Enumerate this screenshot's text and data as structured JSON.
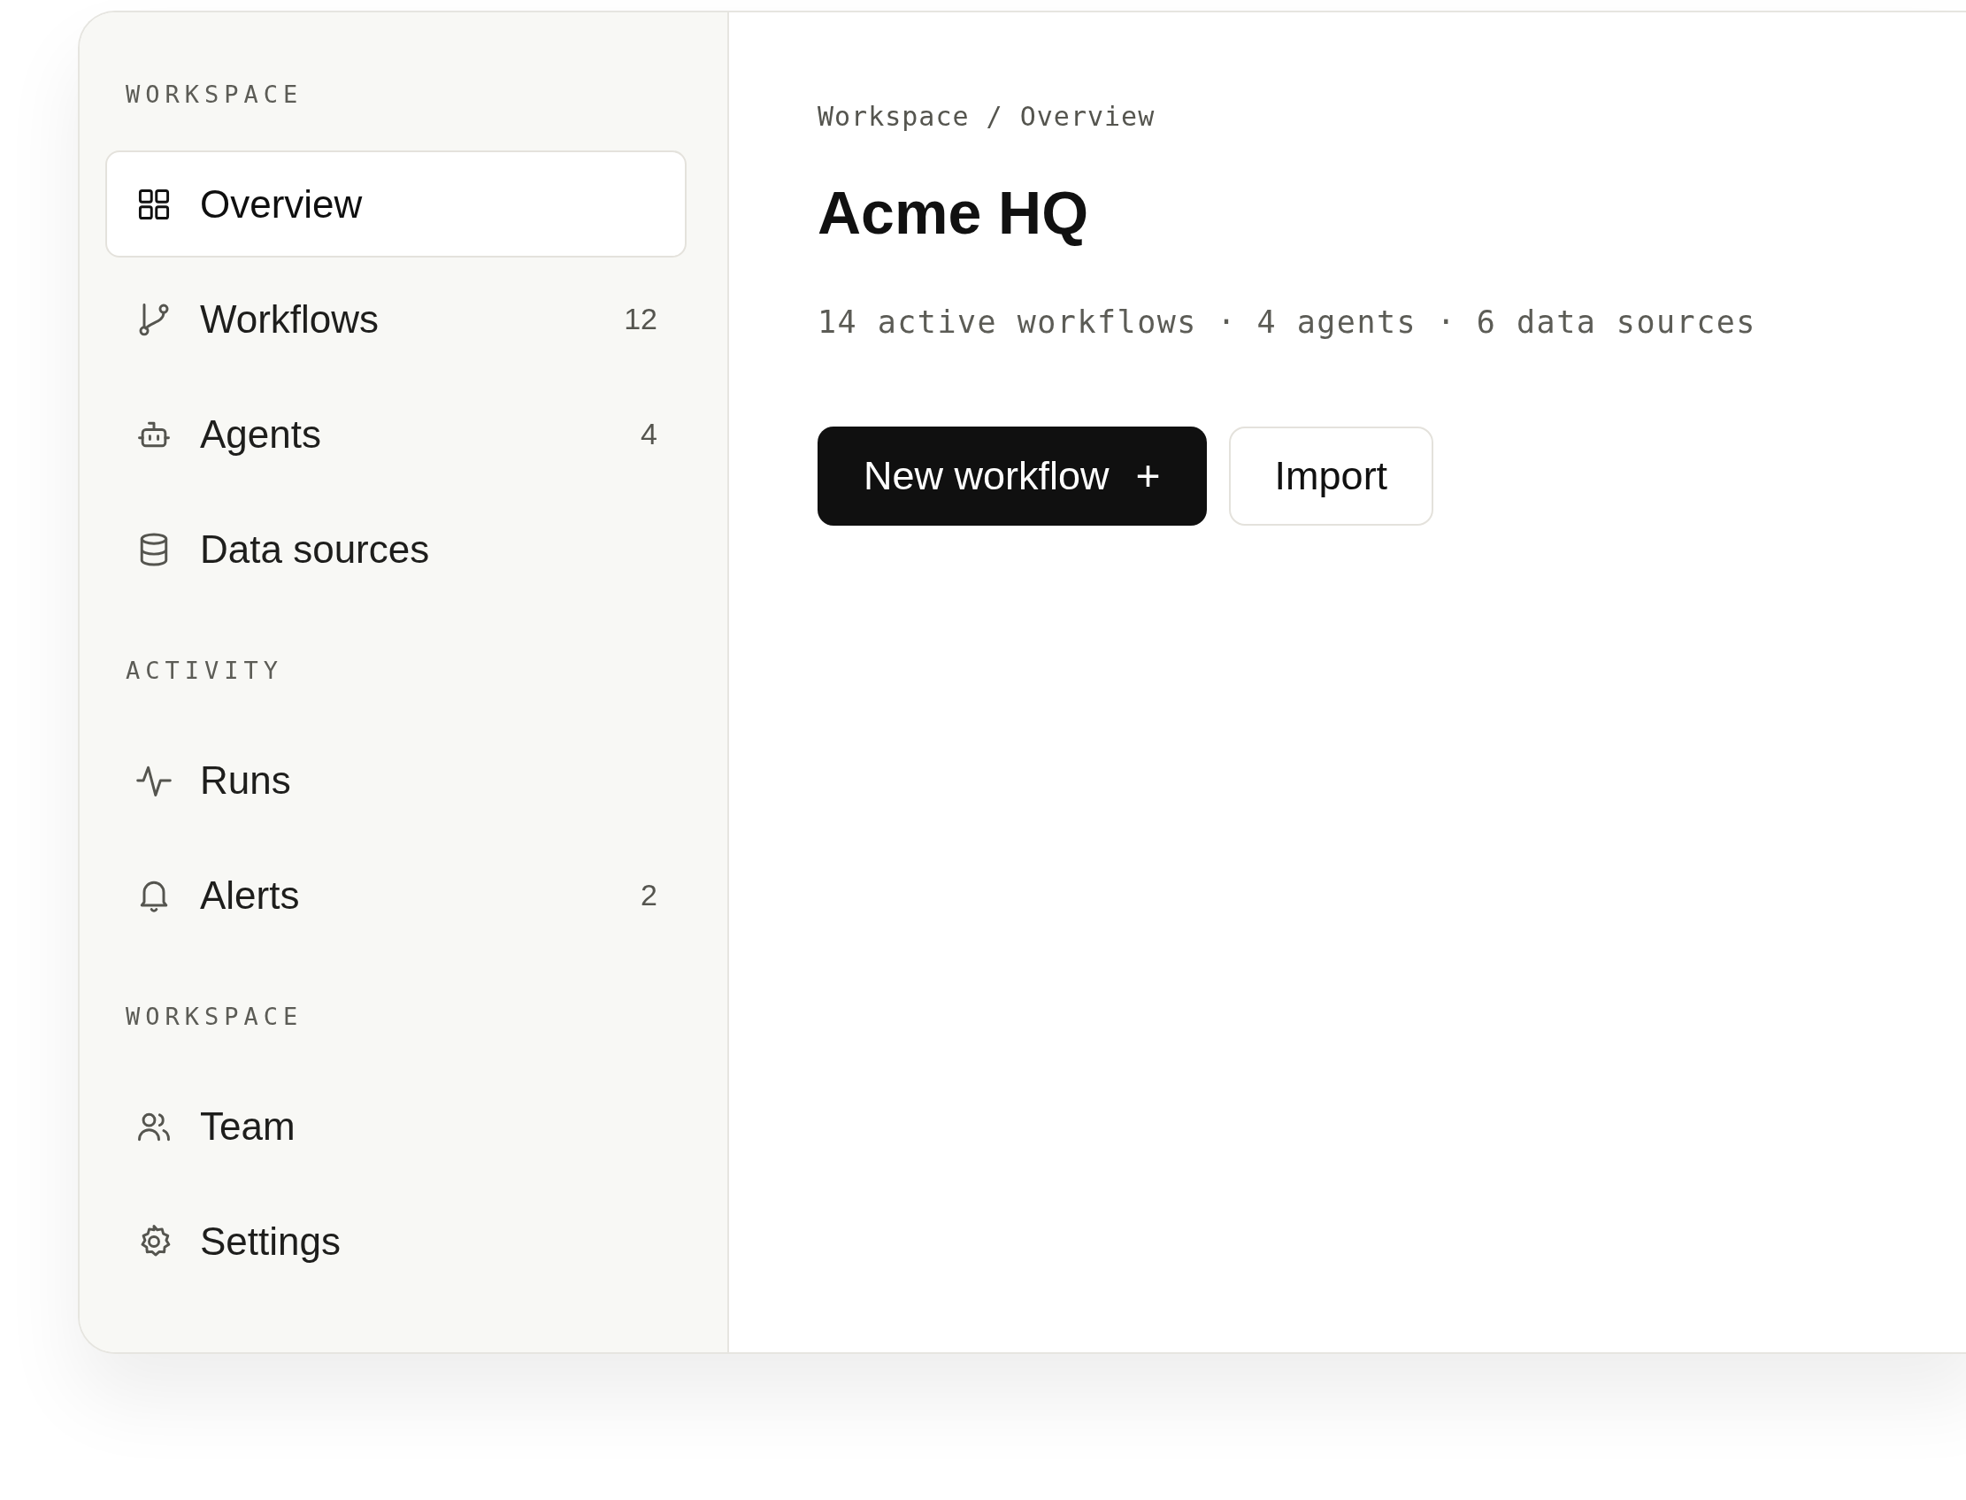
{
  "sidebar": {
    "sections": [
      {
        "label": "WORKSPACE",
        "items": [
          {
            "label": "Overview",
            "selected": true
          },
          {
            "label": "Workflows",
            "count": "12",
            "selected": false
          },
          {
            "label": "Agents",
            "count": "4",
            "selected": false
          },
          {
            "label": "Data sources",
            "selected": false
          }
        ]
      },
      {
        "label": "ACTIVITY",
        "items": [
          {
            "label": "Runs",
            "selected": false
          },
          {
            "label": "Alerts",
            "count": "2",
            "selected": false
          }
        ]
      },
      {
        "label": "WORKSPACE",
        "items": [
          {
            "label": "Team",
            "selected": false
          },
          {
            "label": "Settings",
            "selected": false
          }
        ]
      }
    ]
  },
  "main": {
    "breadcrumb": "Workspace / Overview",
    "title": "Acme HQ",
    "stats": "14 active workflows · 4 agents · 6 data sources",
    "buttons": [
      {
        "label": "New workflow",
        "kind": "primary",
        "icon": "+"
      },
      {
        "label": "Import",
        "kind": "secondary"
      }
    ]
  }
}
